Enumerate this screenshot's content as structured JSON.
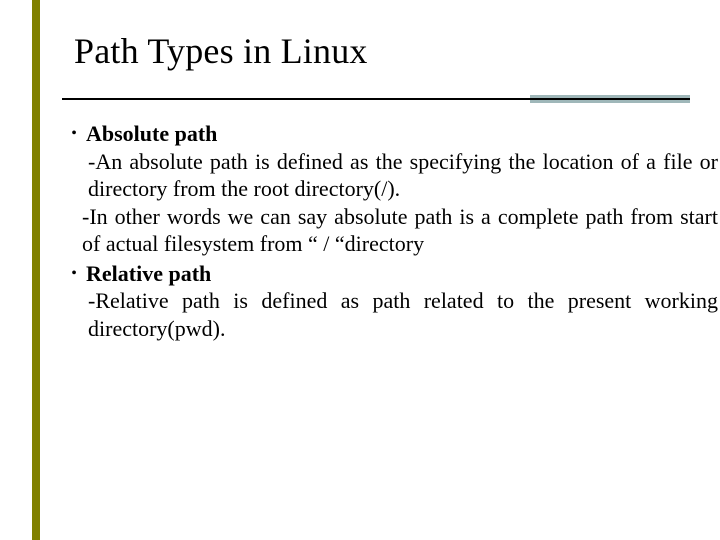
{
  "title": "Path Types in Linux",
  "bullets": [
    {
      "label": "Absolute path",
      "lines": [
        "-An absolute path is defined as the specifying the location of a file or directory from the root directory(/).",
        "-In other words we can say absolute path is a complete path from start of actual filesystem from  “ / “directory"
      ]
    },
    {
      "label": "Relative path",
      "lines": [
        "-Relative path is defined as path related to the present working directory(pwd)."
      ]
    }
  ]
}
